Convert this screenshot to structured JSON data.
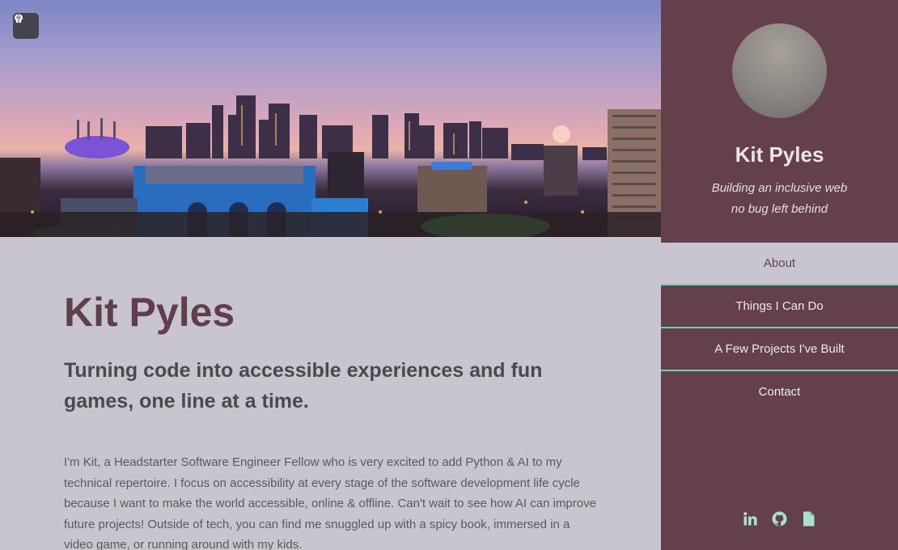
{
  "hero": {
    "image_name": "city-skyline-icon",
    "toggle_icon": "brain-icon"
  },
  "main": {
    "name": "Kit Pyles",
    "tagline": "Turning code into accessible experiences and fun games, one line at a time.",
    "bio": "I'm Kit, a Headstarter Software Engineer Fellow who is very excited to add Python & AI to my technical repertoire. I focus on accessibility at every stage of the software development life cycle because I want to make the world accessible, online & offline. Can't wait to see how AI can improve future projects! Outside of tech, you can find me snuggled up with a spicy book, immersed in a video game, or running around with my kids."
  },
  "sidebar": {
    "name": "Kit Pyles",
    "motto_line1": "Building an inclusive web",
    "motto_line2": "no bug left behind",
    "nav": [
      {
        "label": "About",
        "active": true
      },
      {
        "label": "Things I Can Do",
        "active": false
      },
      {
        "label": "A Few Projects I've Built",
        "active": false
      },
      {
        "label": "Contact",
        "active": false
      }
    ],
    "social": [
      "linkedin-icon",
      "github-icon",
      "document-icon"
    ]
  },
  "colors": {
    "sidebar_bg": "#64404d",
    "main_bg": "#c9c5cf",
    "accent": "#6fd3a9",
    "heading": "#613e4b"
  }
}
